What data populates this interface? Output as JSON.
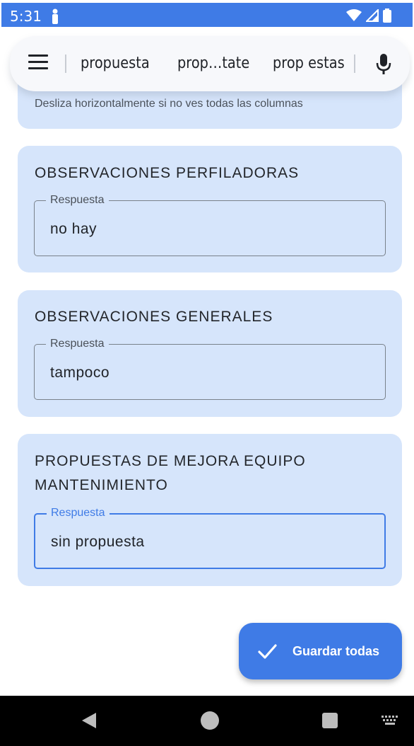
{
  "status_bar": {
    "time": "5:31"
  },
  "suggestions": {
    "items": [
      "propuesta",
      "prop…tate",
      "prop estas"
    ]
  },
  "peek_card": {
    "text": "Desliza horizontalmente si no ves todas las columnas"
  },
  "cards": [
    {
      "title": "OBSERVACIONES PERFILADORAS",
      "field_label": "Respuesta",
      "value": "no hay"
    },
    {
      "title": "OBSERVACIONES GENERALES",
      "field_label": "Respuesta",
      "value": "tampoco"
    },
    {
      "title_line1": "PROPUESTAS DE MEJORA EQUIPO",
      "title_line2": "MANTENIMIENTO",
      "field_label": "Respuesta",
      "value": "sin propuesta"
    }
  ],
  "fab": {
    "label": "Guardar todas",
    "icon": "check-icon"
  },
  "colors": {
    "accent": "#3f7be6",
    "card_bg": "#d6e5fb"
  }
}
